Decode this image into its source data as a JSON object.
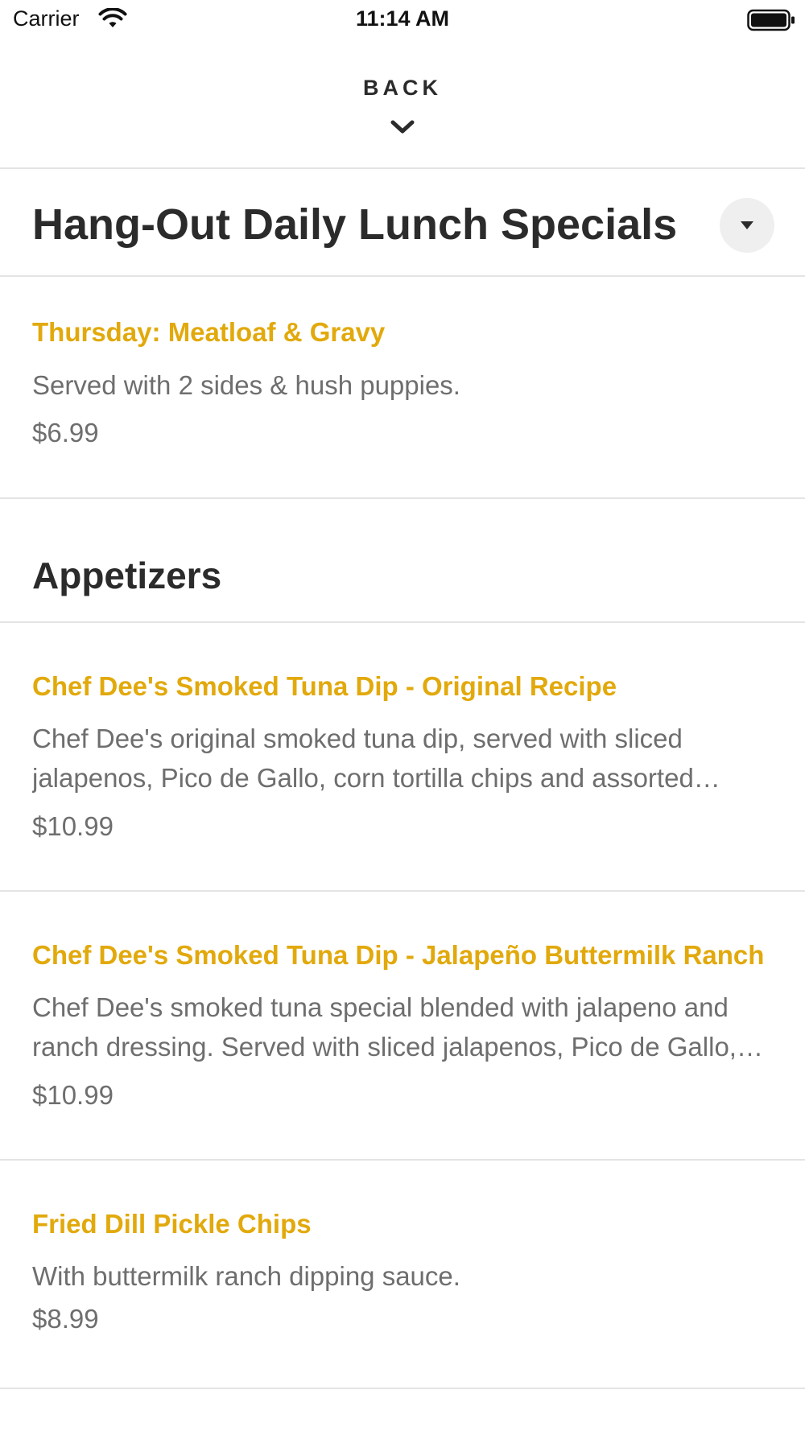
{
  "status_bar": {
    "carrier": "Carrier",
    "time": "11:14 AM",
    "icons": [
      "wifi-icon",
      "battery-icon"
    ]
  },
  "header": {
    "back_label": "BACK",
    "back_icon": "chevron-down-icon"
  },
  "sections": [
    {
      "title": "Hang-Out Daily Lunch Specials",
      "dropdown_icon": "caret-down-icon",
      "items": [
        {
          "name": "Thursday: Meatloaf & Gravy",
          "description": "Served with 2 sides & hush puppies.",
          "price": "$6.99"
        }
      ]
    },
    {
      "title": "Appetizers",
      "items": [
        {
          "name": "Chef Dee's Smoked Tuna Dip - Original Recipe",
          "description": "Chef Dee's original smoked tuna dip, served with sliced jalapenos, Pico de Gallo, corn tortilla chips and assorted crackers.",
          "price": "$10.99"
        },
        {
          "name": "Chef Dee's Smoked Tuna Dip - Jalapeño Buttermilk Ranch",
          "description": "Chef Dee's smoked tuna special blended with jalapeno and ranch dressing. Served with sliced jalapenos, Pico de Gallo, corn tortilla chips and assorted crackers.",
          "price": "$10.99"
        },
        {
          "name": "Fried Dill Pickle Chips",
          "description": "With buttermilk ranch dipping sauce.",
          "price": "$8.99"
        }
      ]
    }
  ],
  "colors": {
    "accent": "#e2a90c",
    "text_dark": "#2b2b2b",
    "text_muted": "#6e6e6e",
    "divider": "#e4e4e4"
  }
}
